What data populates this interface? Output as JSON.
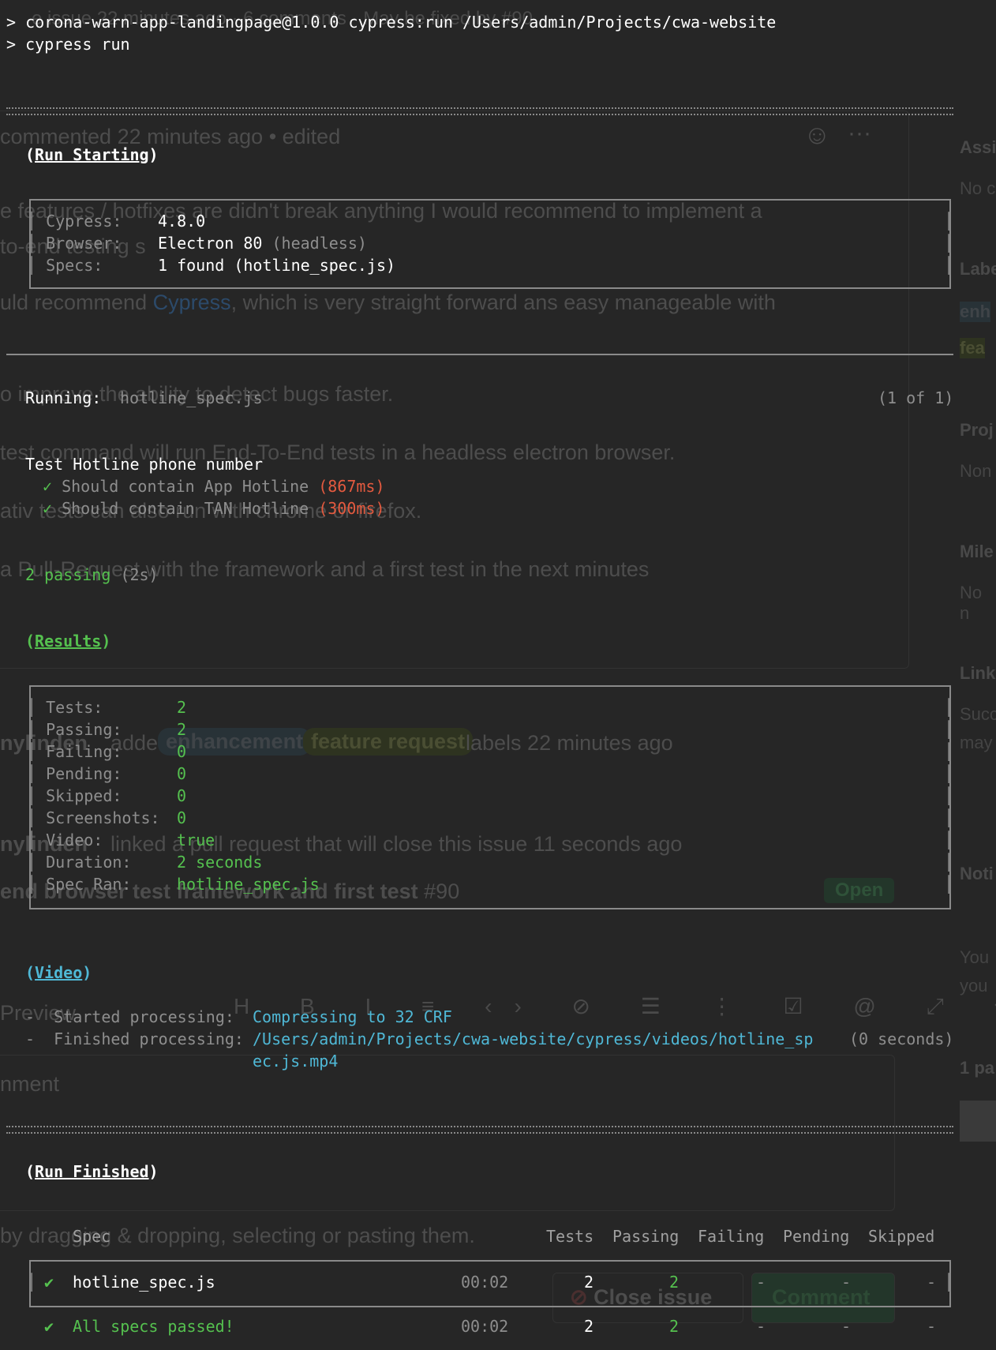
{
  "command": {
    "line1": "> corona-warn-app-landingpage@1.0.0 cypress:run /Users/admin/Projects/cwa-website",
    "line2": "> cypress run"
  },
  "run_starting": {
    "title": "Run Starting",
    "rows": [
      {
        "label": "Cypress:",
        "value": "4.8.0"
      },
      {
        "label": "Browser:",
        "value": "Electron 80",
        "extra": "(headless)"
      },
      {
        "label": "Specs:",
        "value": "1 found (hotline_spec.js)"
      }
    ]
  },
  "running": {
    "label": "Running:",
    "file": "hotline_spec.js",
    "count": "(1 of 1)"
  },
  "suite": {
    "title": "Test Hotline phone number",
    "tests": [
      {
        "mark": "✓",
        "name": "Should contain App Hotline",
        "time": "(867ms)"
      },
      {
        "mark": "✓",
        "name": "Should contain TAN Hotline",
        "time": "(300ms)"
      }
    ],
    "passing": "2 passing",
    "passing_time": "(2s)"
  },
  "results": {
    "title": "Results",
    "rows": [
      {
        "label": "Tests:",
        "value": "2"
      },
      {
        "label": "Passing:",
        "value": "2"
      },
      {
        "label": "Failing:",
        "value": "0"
      },
      {
        "label": "Pending:",
        "value": "0"
      },
      {
        "label": "Skipped:",
        "value": "0"
      },
      {
        "label": "Screenshots:",
        "value": "0"
      },
      {
        "label": "Video:",
        "value": "true"
      },
      {
        "label": "Duration:",
        "value": "2 seconds"
      },
      {
        "label": "Spec Ran:",
        "value": "hotline_spec.js"
      }
    ]
  },
  "video": {
    "title": "Video",
    "started_label": "-  Started processing:",
    "started_value": "Compressing to 32 CRF",
    "finished_label": "-  Finished processing:",
    "finished_value_1": "/Users/admin/Projects/cwa-website/cypress/videos/hotline_sp",
    "finished_value_2": "ec.js.mp4",
    "finished_time": "(0 seconds)"
  },
  "run_finished": {
    "title": "Run Finished",
    "columns": [
      "Spec",
      "Tests",
      "Passing",
      "Failing",
      "Pending",
      "Skipped"
    ],
    "spec_row": {
      "mark": "✔",
      "spec": "hotline_spec.js",
      "time": "00:02",
      "tests": "2",
      "passing": "2",
      "failing": "-",
      "pending": "-",
      "skipped": "-"
    },
    "total_row": {
      "mark": "✔",
      "spec": "All specs passed!",
      "time": "00:02",
      "tests": "2",
      "passing": "2",
      "failing": "-",
      "pending": "-",
      "skipped": "-"
    }
  },
  "background": {
    "top_text": "e issue 22 minutes ago · 6 comments · May be fixed by #90",
    "commented": "commented 22 minutes ago • edited",
    "para1a": "e features / hotfixes are didn't break anything I would recommend to implement a",
    "para1b": "to-end testing s",
    "para2_pre": "uld recommend ",
    "para2_link": "Cypress",
    "para2_post": ", which is very straight forward ans easy manageable with",
    "para3": "o improve the ability to detect bugs faster.",
    "para4": "test command will run End-To-End tests in a headless electron browser.",
    "para5": "ativ tests can also run with chrome or firefox.",
    "para6": "a Pull-Request with the framework and a first test in the next minutes",
    "event1_user": "nylinden",
    "event1_text": "added",
    "label_enh": "enhancement",
    "label_feat": "feature request",
    "event1_tail": "labels 22 minutes ago",
    "event2_user": "nylinden",
    "event2_text": "linked a pull request that will close this issue 11 seconds ago",
    "pr_title": "end browser test framework and first test",
    "pr_num": "#90",
    "pr_state": "Open",
    "preview": "Preview",
    "comment_ph": "nment",
    "attach": "by dragging & dropping, selecting or pasting them.",
    "close_issue": "Close issue",
    "comment_btn": "Comment",
    "sidebar": [
      "Assi",
      "No c",
      "Labe",
      "enh",
      "fea",
      "Proj",
      "Non",
      "Mile",
      "No n",
      "Link",
      "Succ",
      "may",
      "Noti",
      "You",
      "you",
      "1 pa"
    ]
  }
}
